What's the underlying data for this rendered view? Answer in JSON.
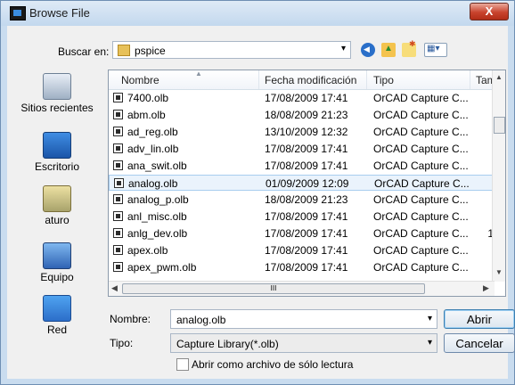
{
  "window": {
    "title": "Browse File",
    "close_glyph": "X"
  },
  "toolbar": {
    "lookin_label": "Buscar en:",
    "lookin_value": "pspice",
    "arrow": "▾"
  },
  "places": [
    {
      "label": "Sitios recientes",
      "icon": "recent-places-icon"
    },
    {
      "label": "Escritorio",
      "icon": "desktop-icon"
    },
    {
      "label": "aturo",
      "icon": "user-folder-icon"
    },
    {
      "label": "Equipo",
      "icon": "computer-icon"
    },
    {
      "label": "Red",
      "icon": "network-icon"
    }
  ],
  "list": {
    "columns": [
      "Nombre",
      "Fecha modificación",
      "Tipo",
      "Tama"
    ],
    "rows": [
      {
        "name": "7400.olb",
        "date": "17/08/2009 17:41",
        "type": "OrCAD Capture C...",
        "size": ""
      },
      {
        "name": "abm.olb",
        "date": "18/08/2009 21:23",
        "type": "OrCAD Capture C...",
        "size": ""
      },
      {
        "name": "ad_reg.olb",
        "date": "13/10/2009 12:32",
        "type": "OrCAD Capture C...",
        "size": ""
      },
      {
        "name": "adv_lin.olb",
        "date": "17/08/2009 17:41",
        "type": "OrCAD Capture C...",
        "size": ""
      },
      {
        "name": "ana_swit.olb",
        "date": "17/08/2009 17:41",
        "type": "OrCAD Capture C...",
        "size": ""
      },
      {
        "name": "analog.olb",
        "date": "01/09/2009 12:09",
        "type": "OrCAD Capture C...",
        "size": "",
        "selected": true
      },
      {
        "name": "analog_p.olb",
        "date": "18/08/2009 21:23",
        "type": "OrCAD Capture C...",
        "size": ""
      },
      {
        "name": "anl_misc.olb",
        "date": "17/08/2009 17:41",
        "type": "OrCAD Capture C...",
        "size": ""
      },
      {
        "name": "anlg_dev.olb",
        "date": "17/08/2009 17:41",
        "type": "OrCAD Capture C...",
        "size": "1"
      },
      {
        "name": "apex.olb",
        "date": "17/08/2009 17:41",
        "type": "OrCAD Capture C...",
        "size": ""
      },
      {
        "name": "apex_pwm.olb",
        "date": "17/08/2009 17:41",
        "type": "OrCAD Capture C...",
        "size": ""
      }
    ],
    "hscroll_grip": "III"
  },
  "bottom": {
    "name_label": "Nombre:",
    "name_value": "analog.olb",
    "type_label": "Tipo:",
    "type_value": "Capture Library(*.olb)",
    "open_button": "Abrir",
    "cancel_button": "Cancelar",
    "readonly_label": "Abrir como archivo de sólo lectura"
  }
}
